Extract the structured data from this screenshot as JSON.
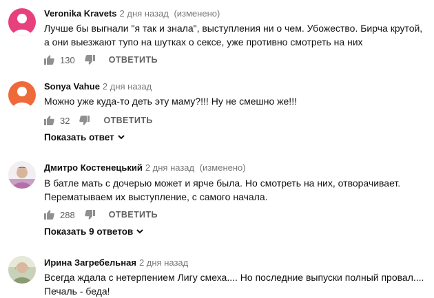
{
  "comments": [
    {
      "author": "Veronika Kravets",
      "time": "2 дня назад",
      "edited": "(изменено)",
      "text": "Лучше бы выгнали \"я так и знала\", выступления ни о чем. Убожество. Бирча крутой, а они выезжают тупо на шутках о сексе, уже противно смотреть на них",
      "likes": "130",
      "reply_label": "ОТВЕТИТЬ",
      "avatar_color": "#e8407c"
    },
    {
      "author": "Sonya Vahue",
      "time": "2 дня назад",
      "text": "Можно уже куда-то деть эту маму?!!! Ну не смешно же!!!",
      "likes": "32",
      "reply_label": "ОТВЕТИТЬ",
      "show_replies": "Показать ответ",
      "avatar_color": "#ef6a3a"
    },
    {
      "author": "Дмитро Костенецький",
      "time": "2 дня назад",
      "edited": "(изменено)",
      "text": "В батле мать с дочерью может и ярче была. Но смотреть на них, отворачивает. Перематываем их выступление, с самого начала.",
      "likes": "288",
      "reply_label": "ОТВЕТИТЬ",
      "show_replies": "Показать 9 ответов",
      "avatar_color": "#c9b7c9"
    },
    {
      "author": "Ирина Загребельная",
      "time": "2 дня назад",
      "text": "Всегда ждала с нетерпением Лигу смеха.... Но последние выпуски полный провал.... Печаль - беда!",
      "avatar_color": "#b8c6a8"
    }
  ],
  "icons": {
    "like": "thumbs-up-icon",
    "dislike": "thumbs-down-icon",
    "expand": "chevron-down-icon"
  },
  "colors": {
    "text_primary": "#111111",
    "text_secondary": "#606060",
    "meta": "#767676"
  }
}
